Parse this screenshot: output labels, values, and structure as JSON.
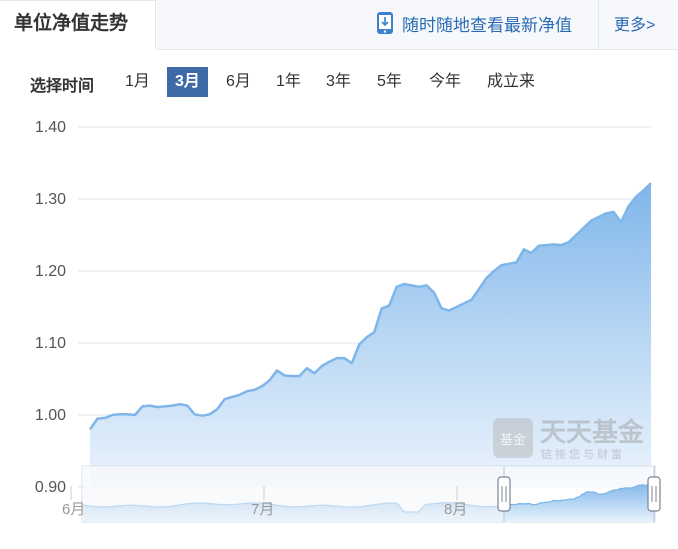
{
  "header": {
    "tab_title": "单位净值走势",
    "mobile_link": "随时随地查看最新净值",
    "more_link": "更多>"
  },
  "time_selector": {
    "label": "选择时间",
    "options": [
      "1月",
      "3月",
      "6月",
      "1年",
      "3年",
      "5年",
      "今年",
      "成立来"
    ],
    "selected": "3月"
  },
  "watermark": {
    "badge": "基金",
    "name": "天天基金",
    "slogan": "链接您与财富"
  },
  "colors": {
    "line": "#7eb6ea",
    "fill_top": "#7fb6ea",
    "fill_bottom": "#e8f2fc",
    "selected_btn": "#3f6aa8",
    "link": "#2a6bb5"
  },
  "chart_data": {
    "type": "area",
    "y_ticks": [
      "1.40",
      "1.30",
      "1.20",
      "1.10",
      "1.00",
      "0.90"
    ],
    "ylim": [
      0.9,
      1.4
    ],
    "grid": true,
    "navigator_x_labels": [
      "6月",
      "7月",
      "8月"
    ],
    "series": [
      {
        "values": [
          0.98,
          0.995,
          0.996,
          1.0,
          1.001,
          1.001,
          1.0,
          1.012,
          1.013,
          1.011,
          1.012,
          1.013,
          1.015,
          1.013,
          1.001,
          0.999,
          1.001,
          1.008,
          1.022,
          1.025,
          1.028,
          1.033,
          1.035,
          1.04,
          1.048,
          1.062,
          1.055,
          1.054,
          1.054,
          1.065,
          1.058,
          1.068,
          1.074,
          1.079,
          1.079,
          1.072,
          1.098,
          1.108,
          1.115,
          1.148,
          1.152,
          1.178,
          1.182,
          1.18,
          1.178,
          1.18,
          1.17,
          1.148,
          1.145,
          1.15,
          1.155,
          1.16,
          1.175,
          1.19,
          1.2,
          1.208,
          1.21,
          1.212,
          1.23,
          1.225,
          1.235,
          1.236,
          1.237,
          1.236,
          1.24,
          1.25,
          1.26,
          1.27,
          1.275,
          1.28,
          1.282,
          1.268,
          1.29,
          1.303,
          1.312,
          1.322
        ]
      }
    ]
  }
}
